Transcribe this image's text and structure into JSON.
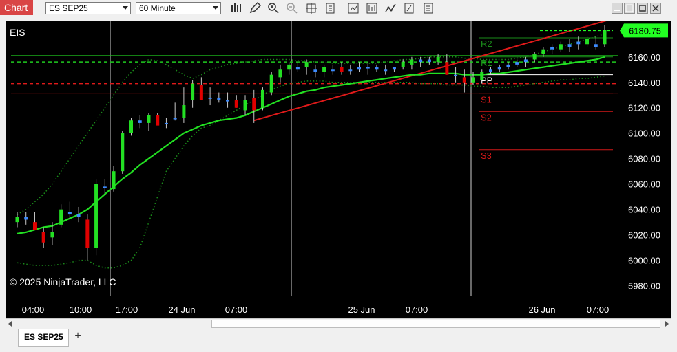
{
  "toolbar": {
    "chart_label": "Chart",
    "instrument": "ES SEP25",
    "interval": "60 Minute",
    "icons": [
      "bar-type-icon",
      "drawing-pencil-icon",
      "zoom-in-icon",
      "zoom-out-icon",
      "crosshair-icon",
      "data-box-icon",
      "strategy-icon",
      "indicators-icon",
      "chart-trader-icon",
      "properties-icon",
      "templates-icon"
    ]
  },
  "window_controls": [
    "minimize",
    "maximize",
    "close"
  ],
  "chart": {
    "symbol": "EIS",
    "copyright": "© 2025 NinjaTrader, LLC",
    "last_price": "6180.75",
    "colors": {
      "up": "#23e023",
      "down": "#e00000",
      "neutral": "#3d8bff",
      "ma": "#22e022",
      "trend": "#e01a1a",
      "accent": "#22ff22"
    }
  },
  "chart_data": {
    "type": "candlestick",
    "y_axis": {
      "ticks": [
        "6160.00",
        "6140.00",
        "6120.00",
        "6100.00",
        "6080.00",
        "6060.00",
        "6040.00",
        "6020.00",
        "6000.00",
        "5980.00"
      ],
      "ylim": [
        5976,
        6188
      ]
    },
    "x_axis": {
      "ticks": [
        "04:00",
        "10:00",
        "17:00",
        "24 Jun",
        "07:00",
        "25 Jun",
        "07:00",
        "26 Jun",
        "07:00"
      ]
    },
    "pivots": [
      {
        "label": "R2",
        "value": 6175
      },
      {
        "label": "R1",
        "value": 6160
      },
      {
        "label": "PP",
        "value": 6146
      },
      {
        "label": "S1",
        "value": 6131
      },
      {
        "label": "S2",
        "value": 6117
      },
      {
        "label": "S3",
        "value": 6087
      }
    ],
    "levels": [
      {
        "value": 6161,
        "style": "solid-green"
      },
      {
        "value": 6156,
        "style": "dashed-green"
      },
      {
        "value": 6139,
        "style": "dashed-red"
      },
      {
        "value": 6131,
        "style": "solid-red"
      }
    ],
    "candles": [
      {
        "o": 6030,
        "h": 6038,
        "l": 6026,
        "c": 6034
      },
      {
        "o": 6032,
        "h": 6038,
        "l": 6028,
        "c": 6034
      },
      {
        "o": 6030,
        "h": 6038,
        "l": 6024,
        "c": 6024
      },
      {
        "o": 6022,
        "h": 6026,
        "l": 6010,
        "c": 6014
      },
      {
        "o": 6018,
        "h": 6030,
        "l": 6012,
        "c": 6022
      },
      {
        "o": 6028,
        "h": 6044,
        "l": 6026,
        "c": 6040
      },
      {
        "o": 6038,
        "h": 6046,
        "l": 6032,
        "c": 6036
      },
      {
        "o": 6034,
        "h": 6042,
        "l": 6030,
        "c": 6036
      },
      {
        "o": 6032,
        "h": 6036,
        "l": 6000,
        "c": 6010
      },
      {
        "o": 6010,
        "h": 6064,
        "l": 6004,
        "c": 6060
      },
      {
        "o": 6058,
        "h": 6064,
        "l": 6052,
        "c": 6058
      },
      {
        "o": 6056,
        "h": 6074,
        "l": 6054,
        "c": 6070
      },
      {
        "o": 6070,
        "h": 6102,
        "l": 6068,
        "c": 6100
      },
      {
        "o": 6100,
        "h": 6112,
        "l": 6098,
        "c": 6110
      },
      {
        "o": 6110,
        "h": 6114,
        "l": 6104,
        "c": 6108
      },
      {
        "o": 6108,
        "h": 6116,
        "l": 6102,
        "c": 6114
      },
      {
        "o": 6114,
        "h": 6116,
        "l": 6108,
        "c": 6106
      },
      {
        "o": 6108,
        "h": 6112,
        "l": 6104,
        "c": 6108
      },
      {
        "o": 6112,
        "h": 6124,
        "l": 6110,
        "c": 6112
      },
      {
        "o": 6112,
        "h": 6136,
        "l": 6108,
        "c": 6122
      },
      {
        "o": 6126,
        "h": 6142,
        "l": 6120,
        "c": 6139
      },
      {
        "o": 6138,
        "h": 6144,
        "l": 6126,
        "c": 6126
      },
      {
        "o": 6128,
        "h": 6136,
        "l": 6122,
        "c": 6128
      },
      {
        "o": 6128,
        "h": 6132,
        "l": 6124,
        "c": 6126
      },
      {
        "o": 6126,
        "h": 6132,
        "l": 6120,
        "c": 6126
      },
      {
        "o": 6126,
        "h": 6130,
        "l": 6120,
        "c": 6120
      },
      {
        "o": 6118,
        "h": 6130,
        "l": 6114,
        "c": 6126
      },
      {
        "o": 6128,
        "h": 6134,
        "l": 6108,
        "c": 6118
      },
      {
        "o": 6120,
        "h": 6136,
        "l": 6118,
        "c": 6134
      },
      {
        "o": 6132,
        "h": 6148,
        "l": 6130,
        "c": 6146
      },
      {
        "o": 6144,
        "h": 6154,
        "l": 6140,
        "c": 6150
      },
      {
        "o": 6150,
        "h": 6156,
        "l": 6146,
        "c": 6154
      },
      {
        "o": 6150,
        "h": 6156,
        "l": 6148,
        "c": 6152
      },
      {
        "o": 6152,
        "h": 6158,
        "l": 6146,
        "c": 6156
      },
      {
        "o": 6150,
        "h": 6154,
        "l": 6144,
        "c": 6148
      },
      {
        "o": 6148,
        "h": 6154,
        "l": 6144,
        "c": 6152
      },
      {
        "o": 6150,
        "h": 6154,
        "l": 6146,
        "c": 6150
      },
      {
        "o": 6152,
        "h": 6156,
        "l": 6146,
        "c": 6148
      },
      {
        "o": 6150,
        "h": 6154,
        "l": 6146,
        "c": 6150
      },
      {
        "o": 6150,
        "h": 6156,
        "l": 6148,
        "c": 6152
      },
      {
        "o": 6152,
        "h": 6156,
        "l": 6146,
        "c": 6152
      },
      {
        "o": 6150,
        "h": 6154,
        "l": 6148,
        "c": 6152
      },
      {
        "o": 6150,
        "h": 6154,
        "l": 6146,
        "c": 6150
      },
      {
        "o": 6150,
        "h": 6152,
        "l": 6148,
        "c": 6152
      },
      {
        "o": 6152,
        "h": 6158,
        "l": 6150,
        "c": 6156
      },
      {
        "o": 6154,
        "h": 6160,
        "l": 6150,
        "c": 6158
      },
      {
        "o": 6156,
        "h": 6160,
        "l": 6152,
        "c": 6158
      },
      {
        "o": 6156,
        "h": 6160,
        "l": 6154,
        "c": 6158
      },
      {
        "o": 6156,
        "h": 6162,
        "l": 6154,
        "c": 6160
      },
      {
        "o": 6156,
        "h": 6162,
        "l": 6146,
        "c": 6146
      },
      {
        "o": 6146,
        "h": 6152,
        "l": 6140,
        "c": 6146
      },
      {
        "o": 6144,
        "h": 6150,
        "l": 6132,
        "c": 6140
      },
      {
        "o": 6140,
        "h": 6148,
        "l": 6138,
        "c": 6144
      },
      {
        "o": 6142,
        "h": 6150,
        "l": 6140,
        "c": 6148
      },
      {
        "o": 6148,
        "h": 6152,
        "l": 6146,
        "c": 6150
      },
      {
        "o": 6150,
        "h": 6154,
        "l": 6148,
        "c": 6152
      },
      {
        "o": 6152,
        "h": 6156,
        "l": 6150,
        "c": 6154
      },
      {
        "o": 6154,
        "h": 6158,
        "l": 6152,
        "c": 6156
      },
      {
        "o": 6156,
        "h": 6160,
        "l": 6152,
        "c": 6158
      },
      {
        "o": 6158,
        "h": 6164,
        "l": 6156,
        "c": 6162
      },
      {
        "o": 6162,
        "h": 6168,
        "l": 6160,
        "c": 6166
      },
      {
        "o": 6166,
        "h": 6170,
        "l": 6162,
        "c": 6168
      },
      {
        "o": 6166,
        "h": 6172,
        "l": 6164,
        "c": 6170
      },
      {
        "o": 6168,
        "h": 6174,
        "l": 6164,
        "c": 6170
      },
      {
        "o": 6170,
        "h": 6176,
        "l": 6166,
        "c": 6172
      },
      {
        "o": 6170,
        "h": 6176,
        "l": 6168,
        "c": 6174
      },
      {
        "o": 6168,
        "h": 6176,
        "l": 6166,
        "c": 6170
      },
      {
        "o": 6170,
        "h": 6185,
        "l": 6168,
        "c": 6181
      }
    ],
    "ma": [
      6021,
      6022,
      6024,
      6026,
      6027,
      6030,
      6033,
      6036,
      6040,
      6046,
      6052,
      6058,
      6064,
      6069,
      6075,
      6080,
      6085,
      6090,
      6095,
      6100,
      6103,
      6106,
      6108,
      6110,
      6111,
      6112,
      6114,
      6117,
      6120,
      6123,
      6126,
      6129,
      6131,
      6133,
      6134,
      6136,
      6137,
      6138,
      6139,
      6140,
      6141,
      6142,
      6143,
      6144,
      6145,
      6146,
      6146,
      6147,
      6147,
      6147,
      6147,
      6146,
      6146,
      6146,
      6147,
      6147,
      6148,
      6149,
      6150,
      6151,
      6152,
      6153,
      6154,
      6155,
      6156,
      6157,
      6158,
      6160
    ],
    "bb_upper": [
      6036,
      6040,
      6046,
      6052,
      6060,
      6070,
      6080,
      6090,
      6100,
      6110,
      6120,
      6130,
      6140,
      6148,
      6154,
      6158,
      6157,
      6154,
      6150,
      6146,
      6143,
      6146,
      6150,
      6152,
      6154,
      6155,
      6156,
      6157,
      6158,
      6158,
      6158,
      6158,
      6157,
      6157,
      6156,
      6156,
      6155,
      6155,
      6155,
      6155,
      6155,
      6155,
      6156,
      6157,
      6158,
      6158,
      6159,
      6160,
      6160,
      6160,
      6160,
      6159,
      6159,
      6158,
      6158,
      6158,
      6158,
      6159,
      6160,
      6162,
      6164,
      6166,
      6168,
      6170,
      6172,
      6174,
      6176,
      6178
    ],
    "bb_lower": [
      5998,
      5997,
      5996,
      5996,
      5996,
      5997,
      5998,
      6000,
      6000,
      5996,
      5994,
      5994,
      5996,
      6000,
      6010,
      6030,
      6050,
      6070,
      6080,
      6090,
      6098,
      6104,
      6106,
      6110,
      6114,
      6118,
      6122,
      6126,
      6130,
      6134,
      6137,
      6139,
      6140,
      6141,
      6141,
      6141,
      6140,
      6140,
      6140,
      6140,
      6140,
      6140,
      6140,
      6140,
      6140,
      6140,
      6139,
      6139,
      6139,
      6138,
      6138,
      6138,
      6137,
      6137,
      6136,
      6136,
      6136,
      6137,
      6138,
      6139,
      6140,
      6141,
      6142,
      6142,
      6143,
      6143,
      6144,
      6145
    ]
  },
  "tabs": {
    "active": "ES SEP25",
    "add_label": "+"
  }
}
